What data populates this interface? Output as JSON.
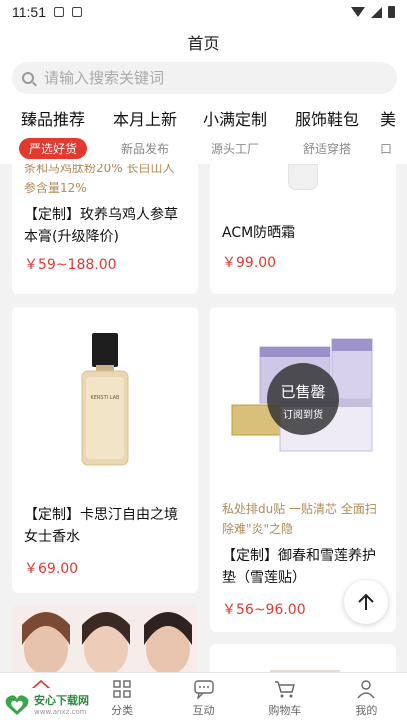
{
  "status_bar": {
    "time": "11:51"
  },
  "header": {
    "title": "首页"
  },
  "search": {
    "placeholder": "请输入搜索关键词"
  },
  "tabs": [
    {
      "label": "臻品推荐",
      "sub": "严选好货",
      "active": true
    },
    {
      "label": "本月上新",
      "sub": "新品发布",
      "active": false
    },
    {
      "label": "小满定制",
      "sub": "源头工厂",
      "active": false
    },
    {
      "label": "服饰鞋包",
      "sub": "舒适穿搭",
      "active": false
    },
    {
      "label": "美",
      "sub": "口",
      "active": false
    }
  ],
  "products": [
    {
      "promo": "条和马鸡肽粉20% 长白山人参含量12%",
      "name": "【定制】玫养乌鸡人参草本膏(升级降价)",
      "price": "￥59~188.00"
    },
    {
      "promo": "",
      "name": "ACM防晒霜",
      "price": "￥99.00"
    },
    {
      "promo": "",
      "name": "【定制】卡思汀自由之境女士香水",
      "price": "￥69.00",
      "bottle_brand": "KERSTI LAB"
    },
    {
      "promo": "私处排du贴 一贴清芯 全面扫除难\"炎\"之隐",
      "name": "【定制】御春和雪莲养护垫（雪莲贴）",
      "price": "￥56~96.00",
      "soldout": "已售罄",
      "soldout_sub": "订阅到货"
    }
  ],
  "bottom_nav": [
    {
      "label": "首页",
      "icon": "home-icon"
    },
    {
      "label": "分类",
      "icon": "category-icon"
    },
    {
      "label": "互动",
      "icon": "chat-icon"
    },
    {
      "label": "购物车",
      "icon": "cart-icon"
    },
    {
      "label": "我的",
      "icon": "user-icon"
    }
  ],
  "watermark": {
    "title": "安心下载网",
    "url": "www.anxz.com"
  }
}
